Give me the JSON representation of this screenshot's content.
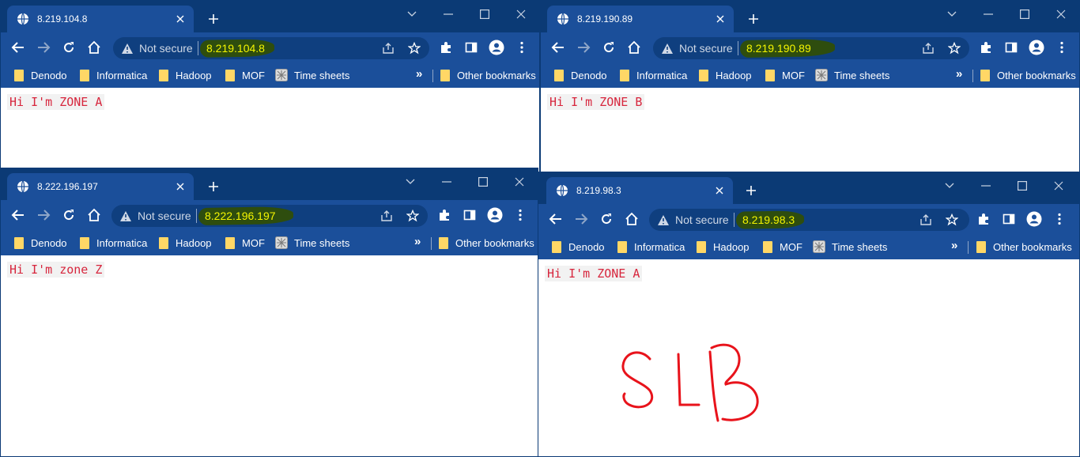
{
  "windows": [
    {
      "tab_title": "8.219.104.8",
      "not_secure": "Not secure",
      "url": "8.219.104.8",
      "bookmarks": [
        "Denodo",
        "Informatica",
        "Hadoop",
        "MOF",
        "Time sheets"
      ],
      "other_bookmarks": "Other bookmarks",
      "page_text": "Hi I'm ZONE A"
    },
    {
      "tab_title": "8.219.190.89",
      "not_secure": "Not secure",
      "url": "8.219.190.89",
      "bookmarks": [
        "Denodo",
        "Informatica",
        "Hadoop",
        "MOF",
        "Time sheets"
      ],
      "other_bookmarks": "Other bookmarks",
      "page_text": "Hi I'm ZONE B"
    },
    {
      "tab_title": "8.222.196.197",
      "not_secure": "Not secure",
      "url": "8.222.196.197",
      "bookmarks": [
        "Denodo",
        "Informatica",
        "Hadoop",
        "MOF",
        "Time sheets"
      ],
      "other_bookmarks": "Other bookmarks",
      "page_text": "Hi I'm zone Z"
    },
    {
      "tab_title": "8.219.98.3",
      "not_secure": "Not secure",
      "url": "8.219.98.3",
      "bookmarks": [
        "Denodo",
        "Informatica",
        "Hadoop",
        "MOF",
        "Time sheets"
      ],
      "other_bookmarks": "Other bookmarks",
      "page_text": "Hi I'm ZONE A"
    }
  ],
  "annotation": {
    "text": "SLB"
  },
  "icons": {
    "tab": [
      "globe-icon",
      "close-icon",
      "plus-icon"
    ],
    "caption": [
      "chevron-down-icon",
      "minimize-icon",
      "maximize-icon",
      "close-icon"
    ],
    "toolbar": [
      "arrow-left-icon",
      "arrow-right-icon",
      "reload-icon",
      "home-icon",
      "warning-icon",
      "share-icon",
      "star-icon",
      "puzzle-icon",
      "side-panel-icon",
      "profile-icon",
      "more-vert-icon"
    ],
    "bookmarks": [
      "folder-icon",
      "time-sheets-icon",
      "chevron-double-right-icon"
    ]
  },
  "colors": {
    "titlebar": "#0b3a75",
    "toolbar": "#1b4f9a",
    "url_text": "#f5f500",
    "page_text": "#d7263d",
    "annotation": "#e8131b"
  }
}
